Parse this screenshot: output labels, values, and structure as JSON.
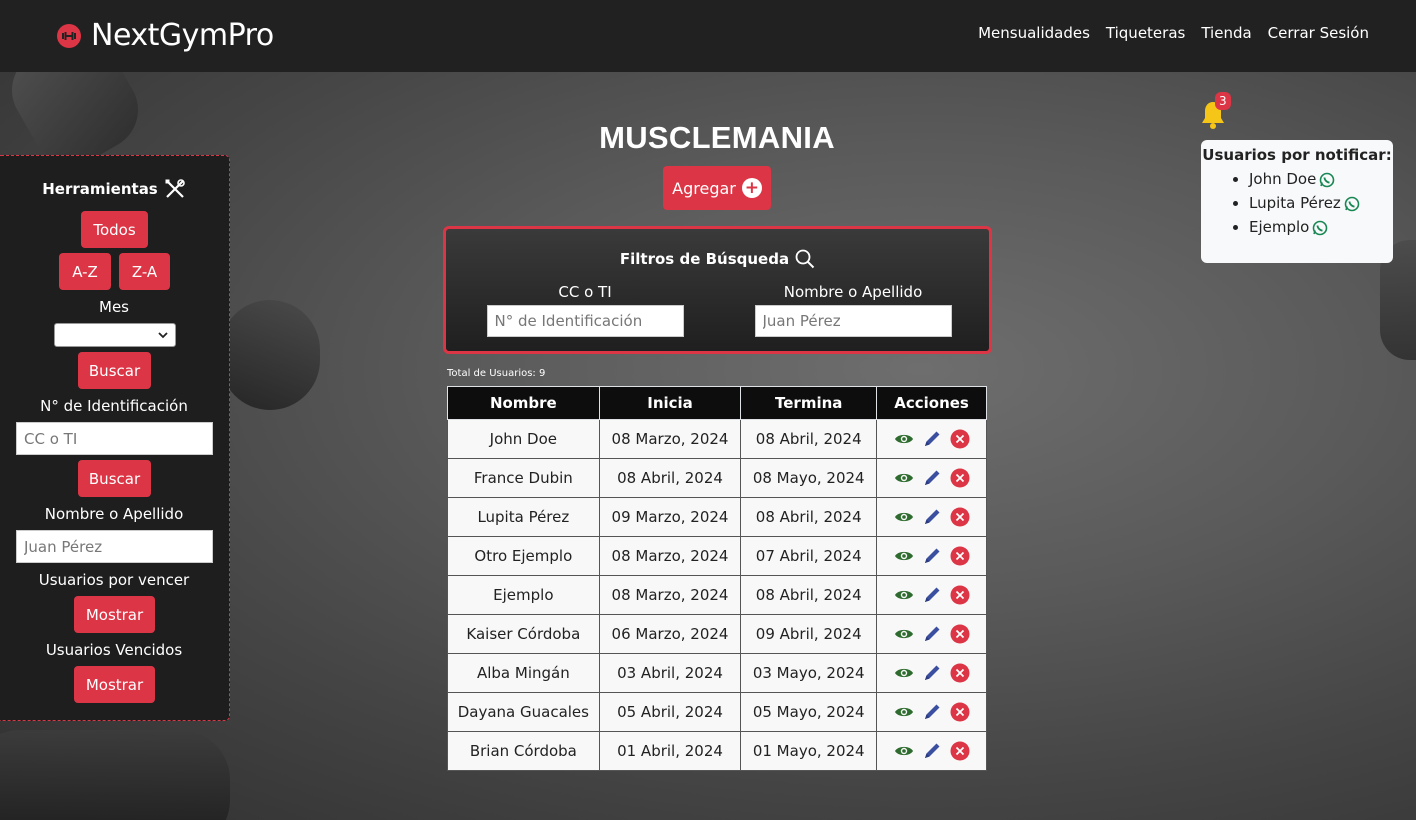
{
  "navbar": {
    "brand": "NextGymPro",
    "links": [
      "Mensualidades",
      "Tiqueteras",
      "Tienda",
      "Cerrar Sesión"
    ]
  },
  "main": {
    "title": "MUSCLEMANIA",
    "add_label": "Agregar"
  },
  "filters": {
    "title": "Filtros de Búsqueda",
    "id_label": "CC o TI",
    "id_placeholder": "N° de Identificación",
    "name_label": "Nombre o Apellido",
    "name_placeholder": "Juan Pérez"
  },
  "table": {
    "total_label": "Total de Usuarios: 9",
    "headers": [
      "Nombre",
      "Inicia",
      "Termina",
      "Acciones"
    ],
    "rows": [
      {
        "nombre": "John Doe",
        "inicia": "08 Marzo, 2024",
        "termina": "08 Abril, 2024"
      },
      {
        "nombre": "France Dubin",
        "inicia": "08 Abril, 2024",
        "termina": "08 Mayo, 2024"
      },
      {
        "nombre": "Lupita Pérez",
        "inicia": "09 Marzo, 2024",
        "termina": "08 Abril, 2024"
      },
      {
        "nombre": "Otro Ejemplo",
        "inicia": "08 Marzo, 2024",
        "termina": "07 Abril, 2024"
      },
      {
        "nombre": "Ejemplo",
        "inicia": "08 Marzo, 2024",
        "termina": "08 Abril, 2024"
      },
      {
        "nombre": "Kaiser Córdoba",
        "inicia": "06 Marzo, 2024",
        "termina": "09 Abril, 2024"
      },
      {
        "nombre": "Alba Mingán",
        "inicia": "03 Abril, 2024",
        "termina": "03 Mayo, 2024"
      },
      {
        "nombre": "Dayana Guacales",
        "inicia": "05 Abril, 2024",
        "termina": "05 Mayo, 2024"
      },
      {
        "nombre": "Brian Córdoba",
        "inicia": "01 Abril, 2024",
        "termina": "01 Mayo, 2024"
      }
    ]
  },
  "sidebar": {
    "title": "Herramientas",
    "todos": "Todos",
    "az": "A-Z",
    "za": "Z-A",
    "mes_label": "Mes",
    "buscar1": "Buscar",
    "id_label": "N° de Identificación",
    "id_placeholder": "CC o TI",
    "buscar2": "Buscar",
    "name_label": "Nombre o Apellido",
    "name_placeholder": "Juan Pérez",
    "por_vencer_label": "Usuarios por vencer",
    "mostrar1": "Mostrar",
    "vencidos_label": "Usuarios Vencidos",
    "mostrar2": "Mostrar"
  },
  "notifications": {
    "count": "3",
    "title": "Usuarios por notificar:",
    "users": [
      "John Doe",
      "Lupita Pérez",
      "Ejemplo"
    ]
  },
  "colors": {
    "accent": "#dc3545",
    "navbar": "#212121",
    "whatsapp": "#198754",
    "view_icon": "#2e6b2e",
    "edit_icon": "#3b4fa0",
    "delete_icon": "#dc3545"
  }
}
